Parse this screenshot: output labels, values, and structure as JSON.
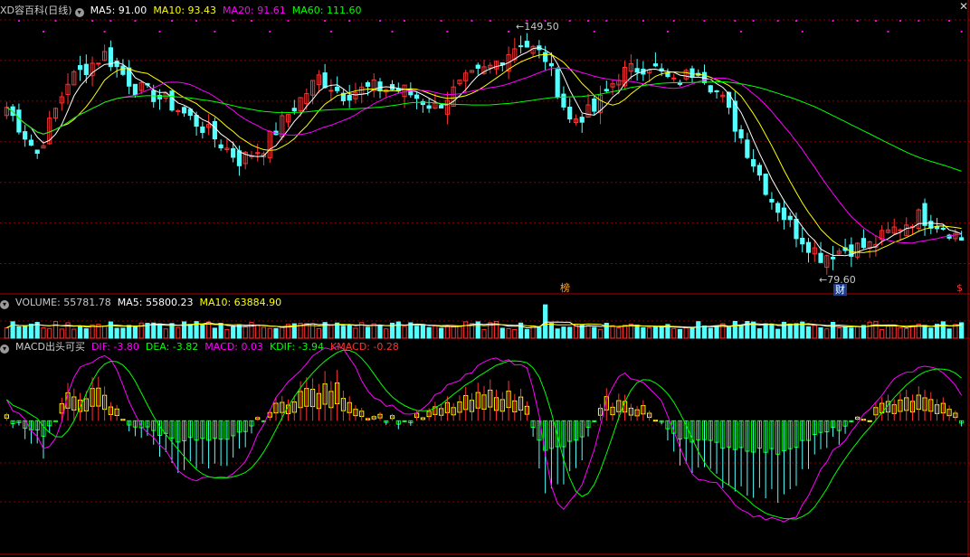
{
  "header": {
    "title": "XD容百科(日线)",
    "ma5": "MA5: 91.00",
    "ma10": "MA10: 93.43",
    "ma20": "MA20: 91.61",
    "ma60": "MA60: 111.60",
    "close_symbol": "✕"
  },
  "volume_header": {
    "title": "VOLUME: 55781.78",
    "ma5": "MA5: 55800.23",
    "ma10": "MA10: 63884.90"
  },
  "macd_header": {
    "title": "MACD出头可买",
    "dif": "DIF: -3.80",
    "dea": "DEA: -3.82",
    "macd": "MACD: 0.03",
    "kdif": "KDIF: -3.94",
    "kmacd": "KMACD: -0.28"
  },
  "markers": {
    "high_label": "149.50",
    "low_label": "79.60",
    "bang": "榜",
    "cai": "财",
    "right_tag": "$"
  },
  "colors": {
    "up": "#ff3232",
    "down": "#54ffff",
    "ma5": "#ffffff",
    "ma10": "#ffff00",
    "ma20": "#ff00ff",
    "ma60": "#00ff00",
    "grid": "#8b0000",
    "macd_pos": "#ffff00",
    "macd_neg": "#00ff00"
  },
  "chart_data": {
    "type": "candlestick",
    "price_range": [
      75,
      155
    ],
    "anchors": [
      {
        "i": 0,
        "p": 128
      },
      {
        "i": 5,
        "p": 114
      },
      {
        "i": 10,
        "p": 136
      },
      {
        "i": 16,
        "p": 144
      },
      {
        "i": 21,
        "p": 134
      },
      {
        "i": 26,
        "p": 130
      },
      {
        "i": 32,
        "p": 122
      },
      {
        "i": 38,
        "p": 112
      },
      {
        "i": 42,
        "p": 116
      },
      {
        "i": 46,
        "p": 126
      },
      {
        "i": 51,
        "p": 137
      },
      {
        "i": 55,
        "p": 132
      },
      {
        "i": 60,
        "p": 134
      },
      {
        "i": 65,
        "p": 133
      },
      {
        "i": 70,
        "p": 128
      },
      {
        "i": 75,
        "p": 136
      },
      {
        "i": 79,
        "p": 140
      },
      {
        "i": 84,
        "p": 148
      },
      {
        "i": 88,
        "p": 143
      },
      {
        "i": 92,
        "p": 124
      },
      {
        "i": 96,
        "p": 127
      },
      {
        "i": 100,
        "p": 138
      },
      {
        "i": 105,
        "p": 141
      },
      {
        "i": 109,
        "p": 135
      },
      {
        "i": 113,
        "p": 140
      },
      {
        "i": 117,
        "p": 130
      },
      {
        "i": 121,
        "p": 115
      },
      {
        "i": 125,
        "p": 100
      },
      {
        "i": 129,
        "p": 90
      },
      {
        "i": 133,
        "p": 83
      },
      {
        "i": 137,
        "p": 85
      },
      {
        "i": 141,
        "p": 86
      },
      {
        "i": 145,
        "p": 91
      },
      {
        "i": 149,
        "p": 95
      },
      {
        "i": 153,
        "p": 92
      },
      {
        "i": 156,
        "p": 88
      }
    ],
    "count": 157,
    "volume_range": [
      0,
      120000
    ],
    "macd_range": [
      -14,
      7
    ],
    "macd_anchors": [
      {
        "i": 0,
        "v": 0.5
      },
      {
        "i": 6,
        "v": -2.5
      },
      {
        "i": 10,
        "v": 2.5
      },
      {
        "i": 15,
        "v": 3
      },
      {
        "i": 20,
        "v": -0.5
      },
      {
        "i": 28,
        "v": -3.5
      },
      {
        "i": 36,
        "v": -4
      },
      {
        "i": 42,
        "v": 0.5
      },
      {
        "i": 48,
        "v": 3
      },
      {
        "i": 54,
        "v": 3.5
      },
      {
        "i": 58,
        "v": 1
      },
      {
        "i": 65,
        "v": -0.3
      },
      {
        "i": 72,
        "v": 1.5
      },
      {
        "i": 80,
        "v": 3
      },
      {
        "i": 85,
        "v": 2
      },
      {
        "i": 88,
        "v": -6
      },
      {
        "i": 93,
        "v": -4
      },
      {
        "i": 98,
        "v": 2
      },
      {
        "i": 104,
        "v": 1.5
      },
      {
        "i": 110,
        "v": -3
      },
      {
        "i": 118,
        "v": -5
      },
      {
        "i": 126,
        "v": -6
      },
      {
        "i": 132,
        "v": -3
      },
      {
        "i": 140,
        "v": 0.2
      },
      {
        "i": 146,
        "v": 2.5
      },
      {
        "i": 152,
        "v": 2
      },
      {
        "i": 156,
        "v": 0.03
      }
    ]
  }
}
